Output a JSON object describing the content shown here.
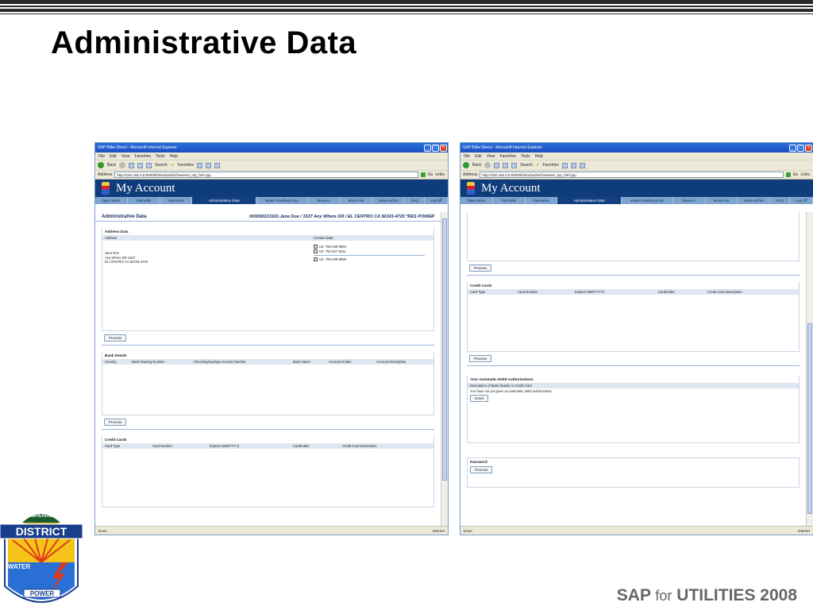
{
  "slide": {
    "title": "Administrative Data",
    "footer_brand_sap": "SAP",
    "footer_brand_for": "for",
    "footer_brand_rest": "UTILITIES 2008"
  },
  "logo": {
    "arc_text": "IMPERIAL",
    "word1": "DISTRICT",
    "word2": "WATER",
    "word3": "POWER"
  },
  "browser": {
    "title": "SAP Biller Direct - Microsoft Internet Explorer",
    "menu": [
      "File",
      "Edit",
      "View",
      "Favorites",
      "Tools",
      "Help"
    ],
    "toolbar": {
      "back": "Back",
      "search": "Search",
      "favorites": "Favorites"
    },
    "address_label": "Address",
    "url": "http://192.168.3.8:50000/bdsu/public/frameset_top_html.jsp",
    "go": "Go",
    "links": "Links",
    "status_done": "Done",
    "status_zone": "Internet"
  },
  "portal": {
    "brand": "My Account",
    "tabs": [
      "Open Items",
      "Paid Bills",
      "Payments",
      "Administrative Data",
      "Water Reading Entry",
      "Move-In",
      "Move-Out",
      "Move-In/Out",
      "FAQ",
      "Log Off"
    ],
    "active_tab": "Administrative Data"
  },
  "left": {
    "page_title": "Administrative Data",
    "account_line": "000050221022-Jane Doe / 1537 Any Where DR / EL CENTRO CA 92243-4720 *RES POWER",
    "address": {
      "section": "Address Data",
      "col_address": "Address",
      "col_contact": "Contact Data",
      "lines": [
        "Jane Doe",
        "Any Where DR 1537",
        "EL CENTRO CA 92243-4720"
      ],
      "phones": [
        {
          "cc": "US",
          "num": "760-339-9946"
        },
        {
          "cc": "US",
          "num": "760-427-0211"
        },
        {
          "cc": "US",
          "num": "760-339-9988"
        }
      ]
    },
    "process_label": "Process",
    "bank": {
      "section": "Bank Details",
      "cols": [
        "Country",
        "Bank Routing Number",
        "Checking/Savings Account Number",
        "Bank Name",
        "Account Holder",
        "Account Description"
      ]
    },
    "credit": {
      "section": "Credit Cards",
      "cols": [
        "Card Type",
        "Card Number",
        "Expires (MM/YYYY)",
        "Cardholder",
        "Credit Card Description"
      ]
    }
  },
  "right": {
    "process_label": "Process",
    "credit": {
      "section": "Credit Cards",
      "cols": [
        "Card Type",
        "Card Number",
        "Expires (MM/YYYY)",
        "Cardholder",
        "Credit Card Description"
      ]
    },
    "debit": {
      "section": "Your Automatic Debit Authorizations",
      "col": "Description of Bank Details or Credit Card",
      "note": "You have not yet given an automatic debit authorization.",
      "grant": "Grant"
    },
    "password": {
      "section": "Password"
    }
  },
  "colors": {
    "nav_active": "#123f7f",
    "banner": "#0f3c7a",
    "nav": "#7da3cf"
  }
}
